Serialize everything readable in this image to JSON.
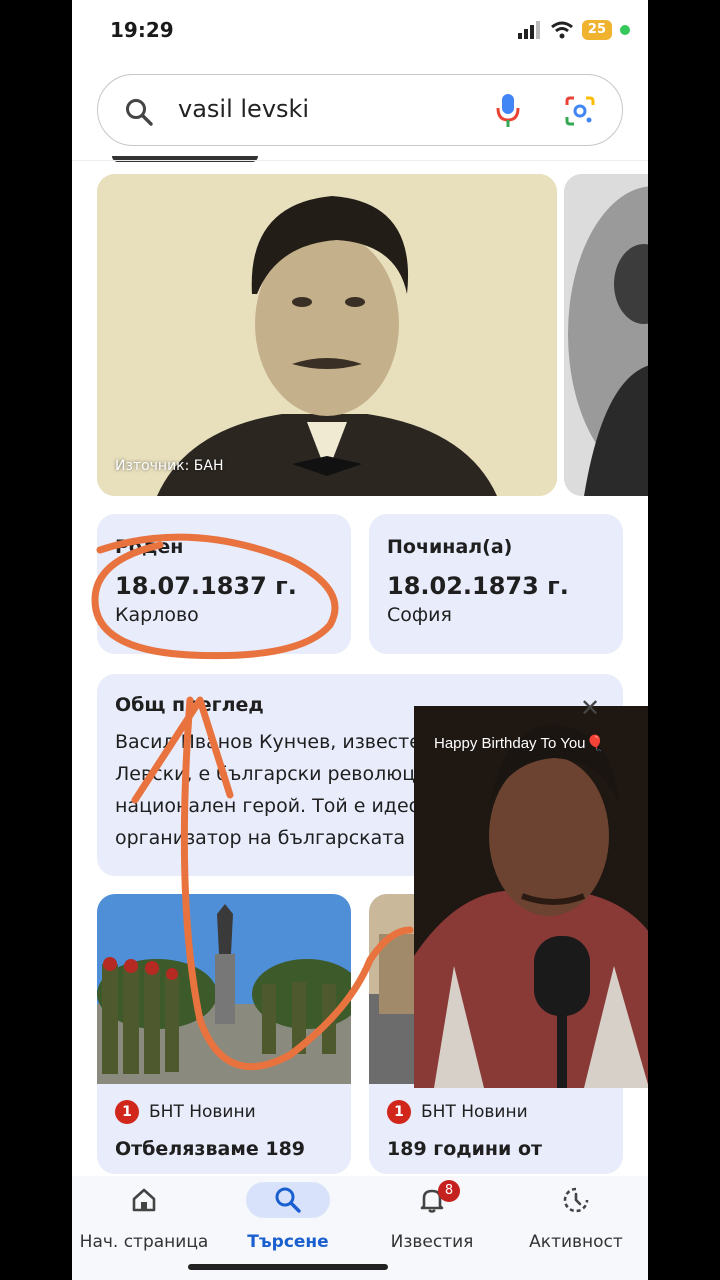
{
  "status": {
    "time": "19:29",
    "battery": "25"
  },
  "search": {
    "query": "vasil levski"
  },
  "images": {
    "source": "Източник: БАН"
  },
  "facts": [
    {
      "label": "Роден",
      "date": "18.07.1837 г.",
      "place": "Карлово"
    },
    {
      "label": "Починал(а)",
      "date": "18.02.1873 г.",
      "place": "София"
    }
  ],
  "overview": {
    "title": "Общ преглед",
    "text": "Васил Иванов Кунчев, известен като Васил Левски, е български революционер и национален герой. Той е идеолог и организатор на българската"
  },
  "news": [
    {
      "source": "БНТ Новини",
      "headline": "Отбелязваме 189"
    },
    {
      "source": "БНТ Новини",
      "headline": "189 години от"
    }
  ],
  "video": {
    "caption": "Happy Birthday To You🎈"
  },
  "nav": {
    "items": [
      {
        "label": "Нач. страница"
      },
      {
        "label": "Търсене"
      },
      {
        "label": "Известия",
        "badge": "8"
      },
      {
        "label": "Активност"
      }
    ]
  },
  "colors": {
    "accent": "#1a5fd0",
    "card": "#e8ecfb",
    "annotation": "#e8733f"
  }
}
